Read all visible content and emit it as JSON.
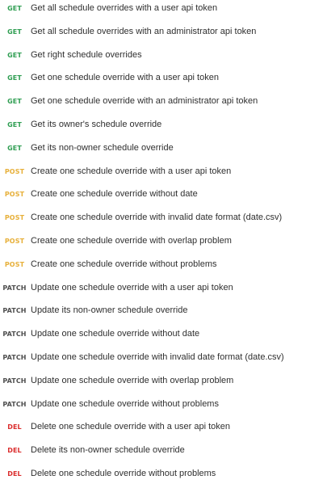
{
  "requests": [
    {
      "method": "GET",
      "name": "Get all schedule overrides with a user api token"
    },
    {
      "method": "GET",
      "name": "Get all schedule overrides with an administrator api token"
    },
    {
      "method": "GET",
      "name": "Get right schedule overrides"
    },
    {
      "method": "GET",
      "name": "Get one schedule override with a user api token"
    },
    {
      "method": "GET",
      "name": "Get one schedule override with an administrator api token"
    },
    {
      "method": "GET",
      "name": "Get its owner's schedule override"
    },
    {
      "method": "GET",
      "name": "Get its non-owner schedule override"
    },
    {
      "method": "POST",
      "name": "Create one schedule override with a user api token"
    },
    {
      "method": "POST",
      "name": "Create one schedule override without date"
    },
    {
      "method": "POST",
      "name": "Create one schedule override with invalid date format (date.csv)"
    },
    {
      "method": "POST",
      "name": "Create one schedule override with overlap problem"
    },
    {
      "method": "POST",
      "name": "Create one schedule override without problems"
    },
    {
      "method": "PATCH",
      "name": "Update one schedule override with a user api token"
    },
    {
      "method": "PATCH",
      "name": "Update its non-owner schedule override"
    },
    {
      "method": "PATCH",
      "name": "Update one schedule override without date"
    },
    {
      "method": "PATCH",
      "name": "Update one schedule override with invalid date format (date.csv)"
    },
    {
      "method": "PATCH",
      "name": "Update one schedule override with overlap problem"
    },
    {
      "method": "PATCH",
      "name": "Update one schedule override without problems"
    },
    {
      "method": "DEL",
      "name": "Delete one schedule override with a user api token"
    },
    {
      "method": "DEL",
      "name": "Delete its non-owner schedule override"
    },
    {
      "method": "DEL",
      "name": "Delete one schedule override without problems"
    }
  ],
  "method_colors": {
    "GET": "#2f9e52",
    "POST": "#e7b03a",
    "PATCH": "#4f4f4f",
    "DEL": "#db2d2d"
  }
}
